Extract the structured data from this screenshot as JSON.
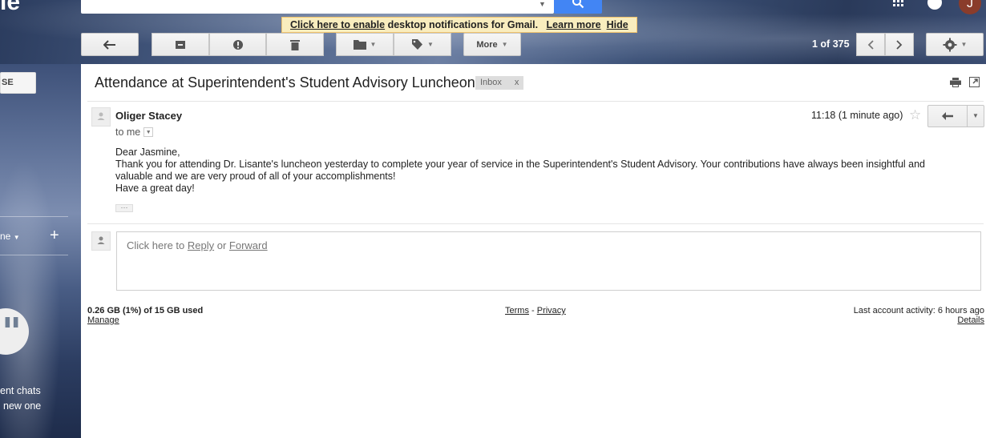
{
  "header": {
    "logo_fragment": "le",
    "avatar_letter": "J"
  },
  "notice": {
    "enable_link": "Click here to enable",
    "message": " desktop notifications for Gmail.",
    "learn_more": "Learn more",
    "hide": "Hide"
  },
  "toolbar": {
    "more_label": "More",
    "pager": "1 of 375"
  },
  "sidebar": {
    "compose_fragment": "SE",
    "me_fragment": "ne",
    "recent_chats_fragment": "ent chats",
    "new_one_fragment": "new one"
  },
  "email": {
    "subject": "Attendance at Superintendent's Student Advisory Luncheon",
    "label": "Inbox",
    "label_remove": "x",
    "sender": "Oliger Stacey",
    "to": "to me",
    "time": "11:18 (1 minute ago)",
    "greeting": "Dear Jasmine,",
    "body": "Thank you for attending Dr. Lisante's luncheon yesterday to complete your year of service in the Superintendent's Student Advisory. Your contributions have always been insightful and valuable and we are very proud of all of your accomplishments!",
    "closing": "Have a great day!"
  },
  "reply": {
    "prefix": "Click here to ",
    "reply_link": "Reply",
    "or": " or ",
    "forward_link": "Forward"
  },
  "footer": {
    "storage": "0.26 GB (1%) of 15 GB used",
    "manage": "Manage",
    "terms": "Terms",
    "dash": " - ",
    "privacy": "Privacy",
    "activity": "Last account activity: 6 hours ago",
    "details": "Details"
  }
}
